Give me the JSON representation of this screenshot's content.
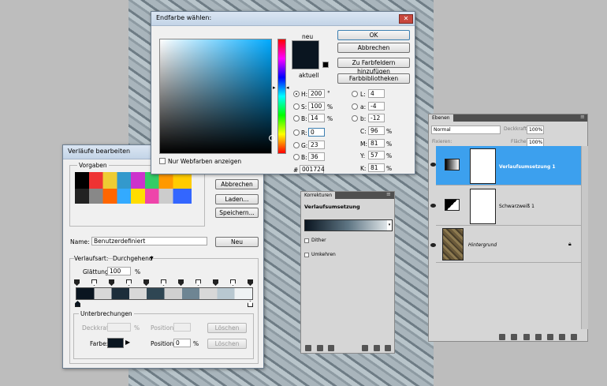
{
  "picker": {
    "title": "Endfarbe wählen:",
    "new_label": "neu",
    "current_label": "aktuell",
    "ok": "OK",
    "cancel": "Abbrechen",
    "add_swatch": "Zu Farbfeldern hinzufügen",
    "libraries": "Farbbibliotheken",
    "h_label": "H:",
    "h": "200",
    "h_unit": "°",
    "s_label": "S:",
    "s": "100",
    "s_unit": "%",
    "b_label": "B:",
    "b": "14",
    "b_unit": "%",
    "r_label": "R:",
    "r": "0",
    "g_label": "G:",
    "g": "23",
    "bb_label": "B:",
    "bb": "36",
    "l_label": "L:",
    "l": "4",
    "a_label": "a:",
    "a": "-4",
    "lab_b_label": "b:",
    "lab_b": "-12",
    "c_label": "C:",
    "c": "96",
    "m_label": "M:",
    "m": "81",
    "y_label": "Y:",
    "y": "57",
    "k_label": "K:",
    "k": "81",
    "pct": "%",
    "hex_label": "#",
    "hex": "001724",
    "web_only": "Nur Webfarben anzeigen",
    "colors": {
      "new": "#0a1520",
      "current": "#000000"
    }
  },
  "gradient_editor": {
    "title": "Verläufe bearbeiten",
    "presets_label": "Vorgaben",
    "cancel": "Abbrechen",
    "load": "Laden...",
    "save": "Speichern...",
    "name_label": "Name:",
    "name_value": "Benutzerdefiniert",
    "new": "Neu",
    "type_label": "Verlaufsart:",
    "type_value": "Durchgehend",
    "smooth_label": "Glättung:",
    "smooth_value": "100",
    "smooth_unit": "%",
    "stops_group": "Unterbrechungen",
    "opacity_label": "Deckkraft:",
    "opacity_unit": "%",
    "position_label": "Position:",
    "delete": "Löschen",
    "color_label": "Farbe:",
    "position2_label": "Position:",
    "position2_value": "0",
    "position2_unit": "%",
    "delete2": "Löschen"
  },
  "corrections": {
    "tab": "Korrekturen",
    "heading": "Verlaufsumsetzung",
    "dither": "Dither",
    "reverse": "Umkehren"
  },
  "layers": {
    "tab": "Ebenen",
    "blend_mode": "Normal",
    "opacity_label": "Deckkraft:",
    "opacity_value": "100%",
    "lock_label": "Fixieren:",
    "fill_label": "Fläche:",
    "fill_value": "100%",
    "items": [
      {
        "name": "Verlaufsumsetzung 1",
        "selected": true
      },
      {
        "name": "Schwarzweiß 1",
        "selected": false
      },
      {
        "name": "Hintergrund",
        "selected": false
      }
    ]
  }
}
